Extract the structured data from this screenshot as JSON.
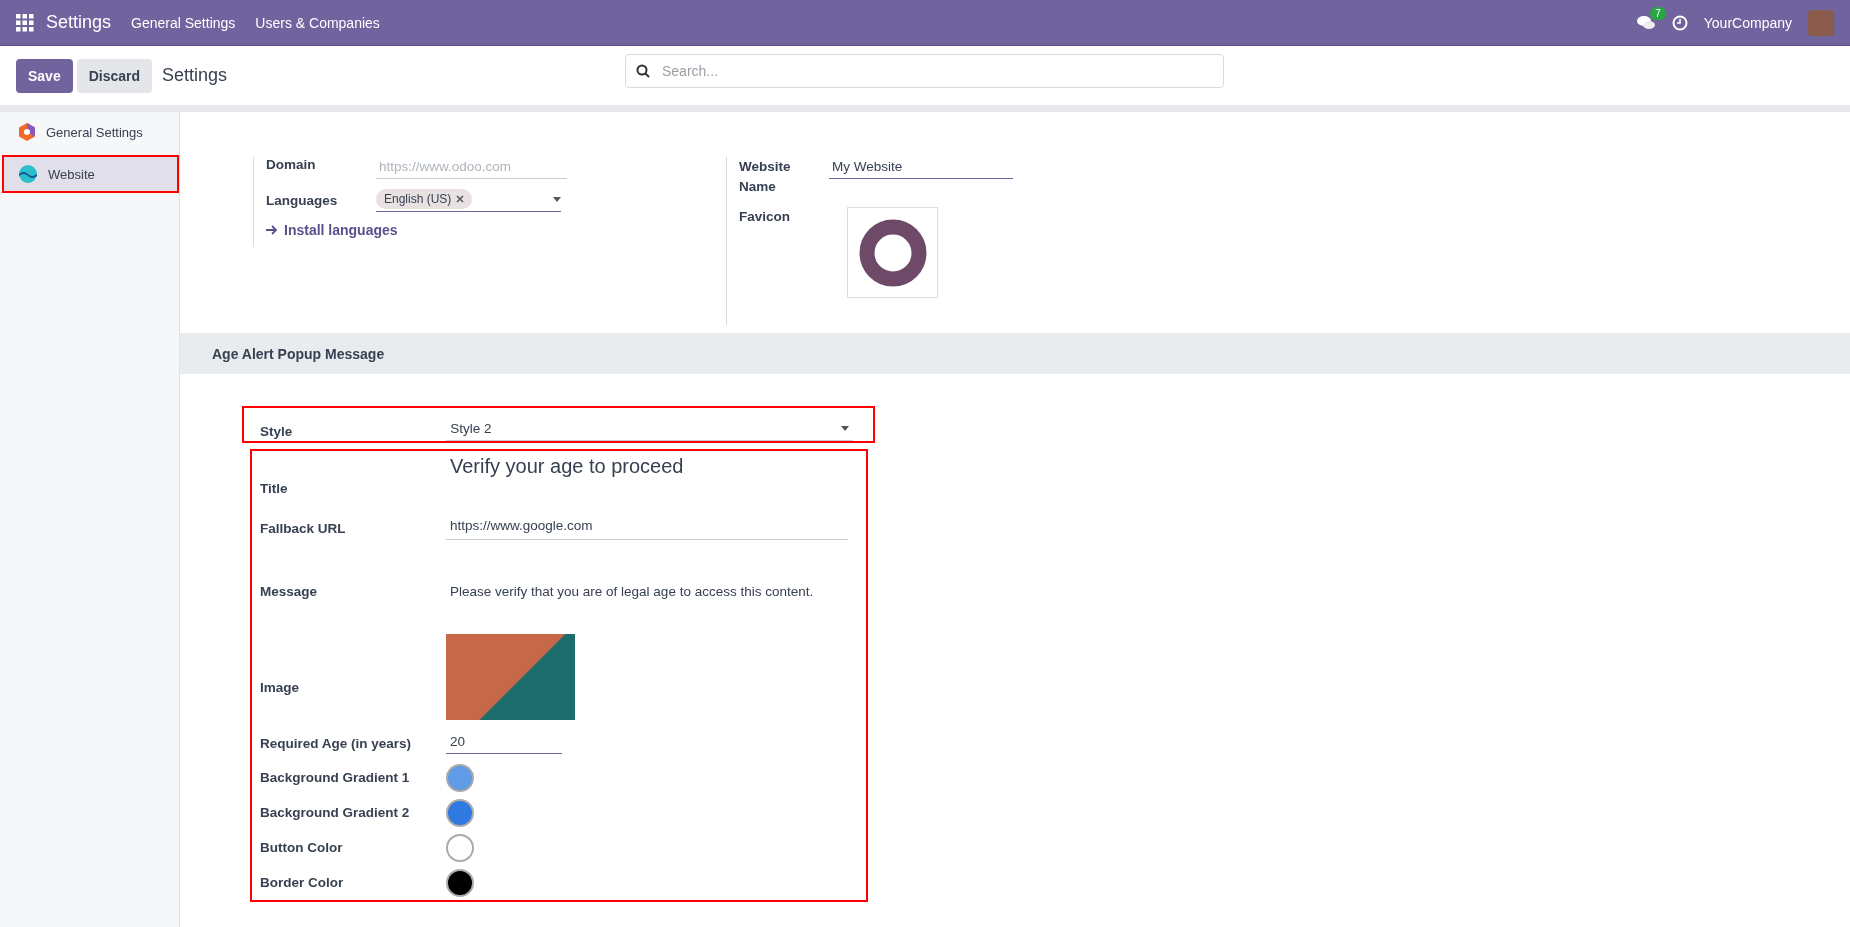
{
  "top_bar": {
    "app_title": "Settings",
    "menu": [
      "General Settings",
      "Users & Companies"
    ],
    "chat_badge": "7",
    "company": "YourCompany"
  },
  "control_panel": {
    "buttons": [
      {
        "label": "Save",
        "kind": "primary"
      },
      {
        "label": "Discard",
        "kind": "secondary"
      }
    ],
    "breadcrumb": "Settings",
    "search": {
      "placeholder": "Search..."
    }
  },
  "sidebar": {
    "items": [
      {
        "label": "General Settings",
        "selected": false,
        "kind": "general"
      },
      {
        "label": "Website",
        "selected": true,
        "kind": "website"
      }
    ]
  },
  "website_settings": {
    "domain": {
      "label": "Domain",
      "placeholder": "https://www.odoo.com"
    },
    "languages": {
      "label": "Languages",
      "tags": [
        "English (US)"
      ]
    },
    "install_link": "Install languages",
    "website_name": {
      "label": "Website Name",
      "value": "My Website"
    },
    "favicon": {
      "label": "Favicon"
    }
  },
  "age_alert": {
    "title": "Age Alert Popup Message",
    "style": {
      "label": "Style",
      "value": "Style 2"
    },
    "fields": [
      {
        "kind": "title",
        "label": "Title",
        "value": "Verify your age to proceed"
      },
      {
        "kind": "input",
        "label": "Fallback URL",
        "value": "https://www.google.com"
      },
      {
        "kind": "text",
        "label": "Message",
        "value": "Please verify that you are of legal age to access this content."
      },
      {
        "kind": "image",
        "label": "Image"
      },
      {
        "kind": "number",
        "label": "Required Age (in years)",
        "value": "20"
      },
      {
        "kind": "color",
        "label": "Background Gradient 1",
        "color": "#5f9be6"
      },
      {
        "kind": "color",
        "label": "Background Gradient 2",
        "color": "#2f7ae0"
      },
      {
        "kind": "color",
        "label": "Button Color",
        "color": "#ffffff"
      },
      {
        "kind": "color",
        "label": "Border Color",
        "color": "#000000"
      }
    ]
  }
}
